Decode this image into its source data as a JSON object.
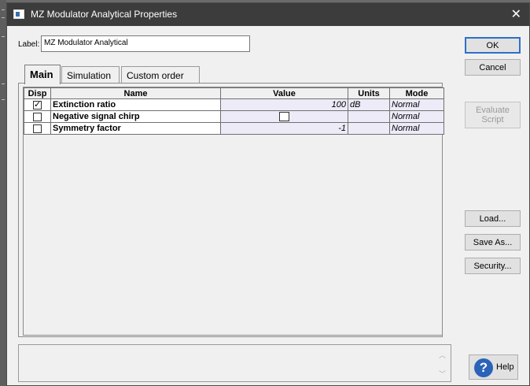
{
  "window": {
    "title": "MZ Modulator Analytical Properties",
    "close_glyph": "✕"
  },
  "label_field": {
    "caption": "Label:",
    "value": "MZ Modulator Analytical"
  },
  "buttons": {
    "ok": "OK",
    "cancel": "Cancel",
    "evaluate_line1": "Evaluate",
    "evaluate_line2": "Script",
    "load": "Load...",
    "save_as": "Save As...",
    "security": "Security...",
    "help": "Help"
  },
  "tabs": [
    {
      "label": "Main",
      "active": true
    },
    {
      "label": "Simulation",
      "active": false
    },
    {
      "label": "Custom order",
      "active": false
    }
  ],
  "table": {
    "headers": {
      "disp": "Disp",
      "name": "Name",
      "value": "Value",
      "units": "Units",
      "mode": "Mode"
    },
    "rows": [
      {
        "disp_checked": true,
        "name": "Extinction ratio",
        "value": "100",
        "units": "dB",
        "mode": "Normal"
      },
      {
        "disp_checked": false,
        "name": "Negative signal chirp",
        "value_checkbox": false,
        "units": "",
        "mode": "Normal"
      },
      {
        "disp_checked": false,
        "name": "Symmetry factor",
        "value": "-1",
        "units": "",
        "mode": "Normal"
      }
    ]
  },
  "icons": {
    "app": "window-icon",
    "help": "question-mark-icon",
    "scroll_up": "chevron-up-icon",
    "scroll_down": "chevron-down-icon"
  },
  "colors": {
    "titlebar": "#3c3c3c",
    "value_cell": "#ecebf7",
    "default_button_border": "#2f6fc9",
    "help_icon": "#2a63b8"
  }
}
